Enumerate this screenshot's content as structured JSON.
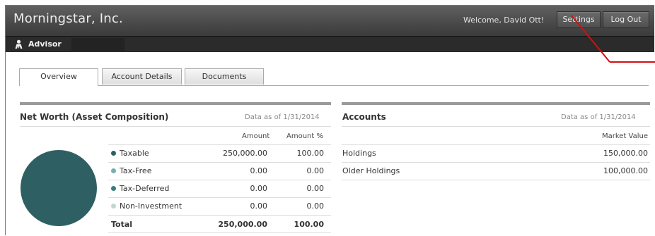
{
  "header": {
    "brand": "Morningstar, Inc.",
    "welcome": "Welcome, David Ott!",
    "settings_label": "Settings",
    "logout_label": "Log Out"
  },
  "subbar": {
    "role": "Advisor"
  },
  "tabs": [
    {
      "label": "Overview",
      "active": true
    },
    {
      "label": "Account Details",
      "active": false
    },
    {
      "label": "Documents",
      "active": false
    }
  ],
  "net_worth": {
    "title": "Net Worth (Asset Composition)",
    "as_of": "Data as of 1/31/2014",
    "columns": [
      "Amount",
      "Amount %"
    ],
    "rows": [
      {
        "label": "Taxable",
        "amount": "250,000.00",
        "pct": "100.00",
        "color": "#2e5f62"
      },
      {
        "label": "Tax-Free",
        "amount": "0.00",
        "pct": "0.00",
        "color": "#78aeb0"
      },
      {
        "label": "Tax-Deferred",
        "amount": "0.00",
        "pct": "0.00",
        "color": "#3b7b7e"
      },
      {
        "label": "Non-Investment",
        "amount": "0.00",
        "pct": "0.00",
        "color": "#c3d6d7"
      }
    ],
    "total": {
      "label": "Total",
      "amount": "250,000.00",
      "pct": "100.00"
    }
  },
  "chart_data": {
    "type": "pie",
    "categories": [
      "Taxable",
      "Tax-Free",
      "Tax-Deferred",
      "Non-Investment"
    ],
    "values": [
      250000,
      0,
      0,
      0
    ]
  },
  "accounts": {
    "title": "Accounts",
    "as_of": "Data as of 1/31/2014",
    "column": "Market Value",
    "rows": [
      {
        "label": "Holdings",
        "value": "150,000.00"
      },
      {
        "label": "Older Holdings",
        "value": "100,000.00"
      }
    ]
  },
  "colors": {
    "header": "#4a4a4a",
    "subbar": "#2b2b2b",
    "callout": "#d11010",
    "pie": "#2e5f62"
  }
}
